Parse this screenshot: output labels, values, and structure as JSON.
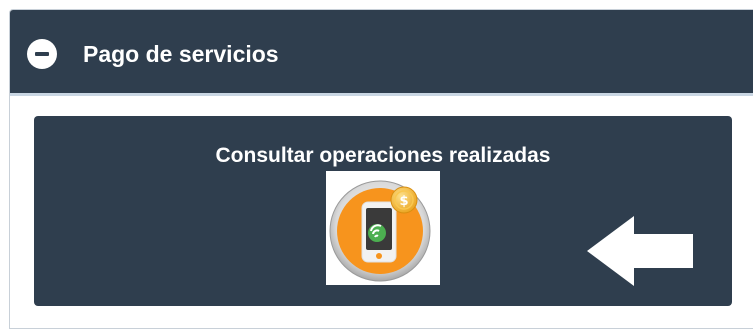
{
  "section": {
    "title": "Pago de servicios",
    "collapse_icon": "minus-circle-icon",
    "colors": {
      "header_bg": "#2f3e4e",
      "tile_bg": "#2f3e4e",
      "icon_orange": "#f7941d",
      "coin_gold": "#f5b335"
    }
  },
  "tile": {
    "title": "Consultar operaciones realizadas",
    "image_icon": "mobile-payment-icon",
    "arrow_icon": "arrow-left-icon"
  }
}
